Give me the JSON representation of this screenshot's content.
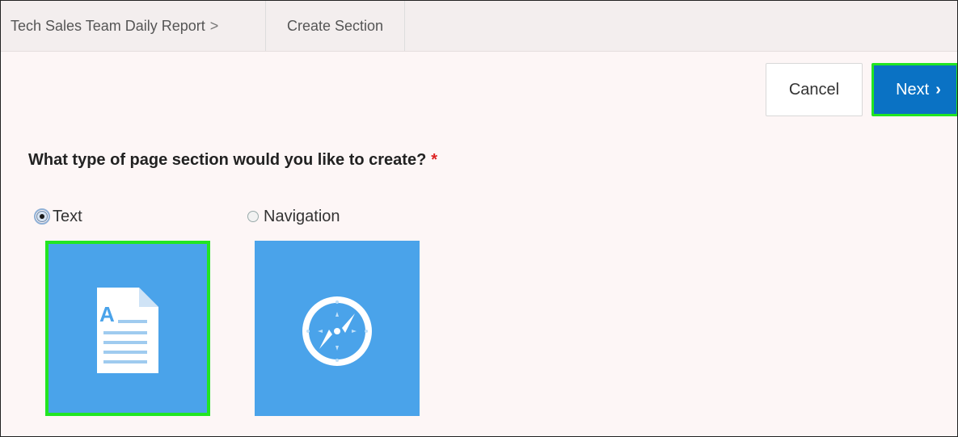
{
  "breadcrumb": {
    "item1": "Tech Sales Team Daily Report",
    "separator": ">",
    "item2": "Create Section"
  },
  "actions": {
    "cancel_label": "Cancel",
    "next_label": "Next",
    "next_chevron": "›"
  },
  "form": {
    "question": "What type of page section would you like to create?",
    "required_marker": "*",
    "options": [
      {
        "label": "Text",
        "selected": true,
        "icon": "document-icon"
      },
      {
        "label": "Navigation",
        "selected": false,
        "icon": "compass-icon"
      }
    ]
  },
  "colors": {
    "primary": "#0a72c4",
    "tile": "#4aa3ea",
    "highlight": "#22e522",
    "required": "#dd2222"
  }
}
